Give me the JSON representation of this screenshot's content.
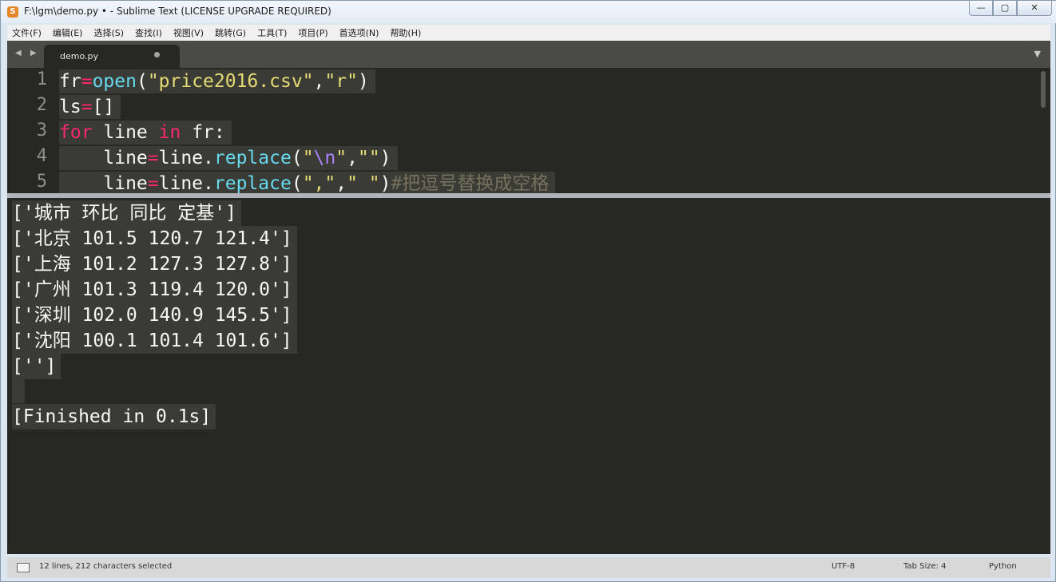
{
  "window": {
    "title": "F:\\lgm\\demo.py • - Sublime Text (LICENSE UPGRADE REQUIRED)",
    "app_icon": "sublime-icon",
    "minimize_glyph": "—",
    "maximize_glyph": "▢",
    "close_glyph": "✕"
  },
  "menu": {
    "items": [
      "文件(F)",
      "编辑(E)",
      "选择(S)",
      "查找(I)",
      "视图(V)",
      "跳转(G)",
      "工具(T)",
      "项目(P)",
      "首选项(N)",
      "帮助(H)"
    ]
  },
  "tabs": {
    "nav_arrows": "◀ ▶",
    "active": {
      "label": "demo.py"
    },
    "menu_glyph": "▼"
  },
  "editor": {
    "line_numbers": [
      "1",
      "2",
      "3",
      "4",
      "5"
    ],
    "lines": [
      "fr=open(\"price2016.csv\",\"r\")",
      "ls=[]",
      "for line in fr:",
      "    line=line.replace(\"\\n\",\"\")",
      "    line=line.replace(\",\",\" \")#把逗号替换成空格"
    ]
  },
  "output": {
    "lines": [
      "['城市 环比 同比 定基']",
      "['北京 101.5 120.7 121.4']",
      "['上海 101.2 127.3 127.8']",
      "['广州 101.3 119.4 120.0']",
      "['深圳 102.0 140.9 145.5']",
      "['沈阳 100.1 101.4 101.6']",
      "['']",
      "",
      "[Finished in 0.1s]"
    ]
  },
  "status": {
    "selection": "12 lines, 212 characters selected",
    "encoding": "UTF-8",
    "tab_size": "Tab Size: 4",
    "syntax": "Python"
  },
  "colors": {
    "editor_bg": "#272822",
    "keyword": "#f92672",
    "function": "#66d9ef",
    "string": "#e6db74",
    "escape": "#ae81ff",
    "comment": "#75715e"
  }
}
